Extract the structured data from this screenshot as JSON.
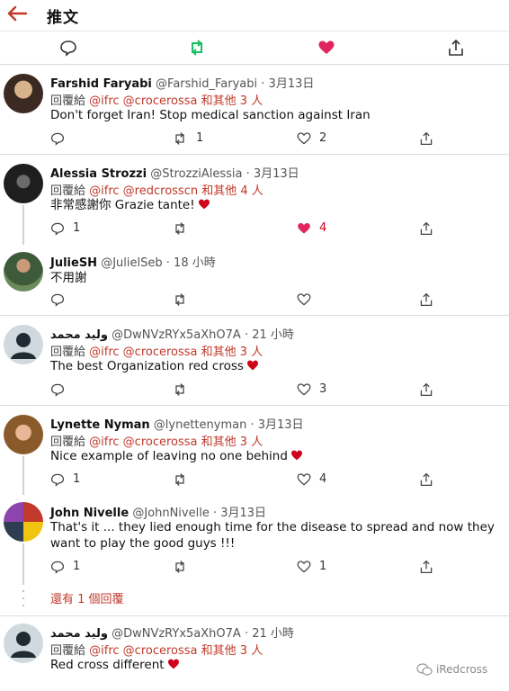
{
  "header": {
    "title": "推文"
  },
  "tweets": [
    {
      "name": "Farshid Faryabi",
      "handle": "@Farshid_Faryabi",
      "time": "· 3月13日",
      "reply_prefix": "回覆給",
      "mentions": "@ifrc @crocerossa",
      "others": "和其他 3 人",
      "text": "Don't forget Iran! Stop medical sanction against Iran",
      "retweets": "1",
      "likes": "2"
    },
    {
      "name": "Alessia Strozzi",
      "handle": "@StrozziAlessia",
      "time": "· 3月13日",
      "reply_prefix": "回覆給",
      "mentions": "@ifrc @redcrosscn",
      "others": "和其他 4 人",
      "text": "非常感謝你 Grazie tante!",
      "replies": "1",
      "likes": "4"
    },
    {
      "name": "JulieSH",
      "handle": "@JulielSeb",
      "time": "· 18 小時",
      "text": "不用謝"
    },
    {
      "name": "وليد محمد",
      "handle": "@DwNVzRYx5aXhO7A",
      "time": "· 21 小時",
      "reply_prefix": "回覆給",
      "mentions": "@ifrc @crocerossa",
      "others": "和其他 3 人",
      "text": "The best Organization red cross",
      "likes": "3"
    },
    {
      "name": "Lynette Nyman",
      "handle": "@lynettenyman",
      "time": "· 3月13日",
      "reply_prefix": "回覆給",
      "mentions": "@ifrc @crocerossa",
      "others": "和其他 3 人",
      "text": "Nice example of leaving no one behind",
      "replies": "1",
      "likes": "4"
    },
    {
      "name": "John Nivelle",
      "handle": "@JohnNivelle",
      "time": "· 3月13日",
      "text": "That's it ... they lied enough time for the disease to spread and now they want to play the good guys !!!",
      "replies": "1",
      "likes": "1"
    },
    {
      "name": "وليد محمد",
      "handle": "@DwNVzRYx5aXhO7A",
      "time": "· 21 小時",
      "reply_prefix": "回覆給",
      "mentions": "@ifrc @crocerossa",
      "others": "和其他 3 人",
      "text": "Red cross different"
    }
  ],
  "more_replies": "還有 1 個回覆",
  "watermark": "iRedcross",
  "colors": {
    "accent_red": "#c0392b",
    "retweet_green": "#17bf63",
    "like_red": "#e0245e",
    "icon_gray": "#444444"
  },
  "icons": [
    "back-arrow-icon",
    "reply-icon",
    "retweet-icon",
    "like-icon",
    "share-icon",
    "wechat-icon"
  ]
}
